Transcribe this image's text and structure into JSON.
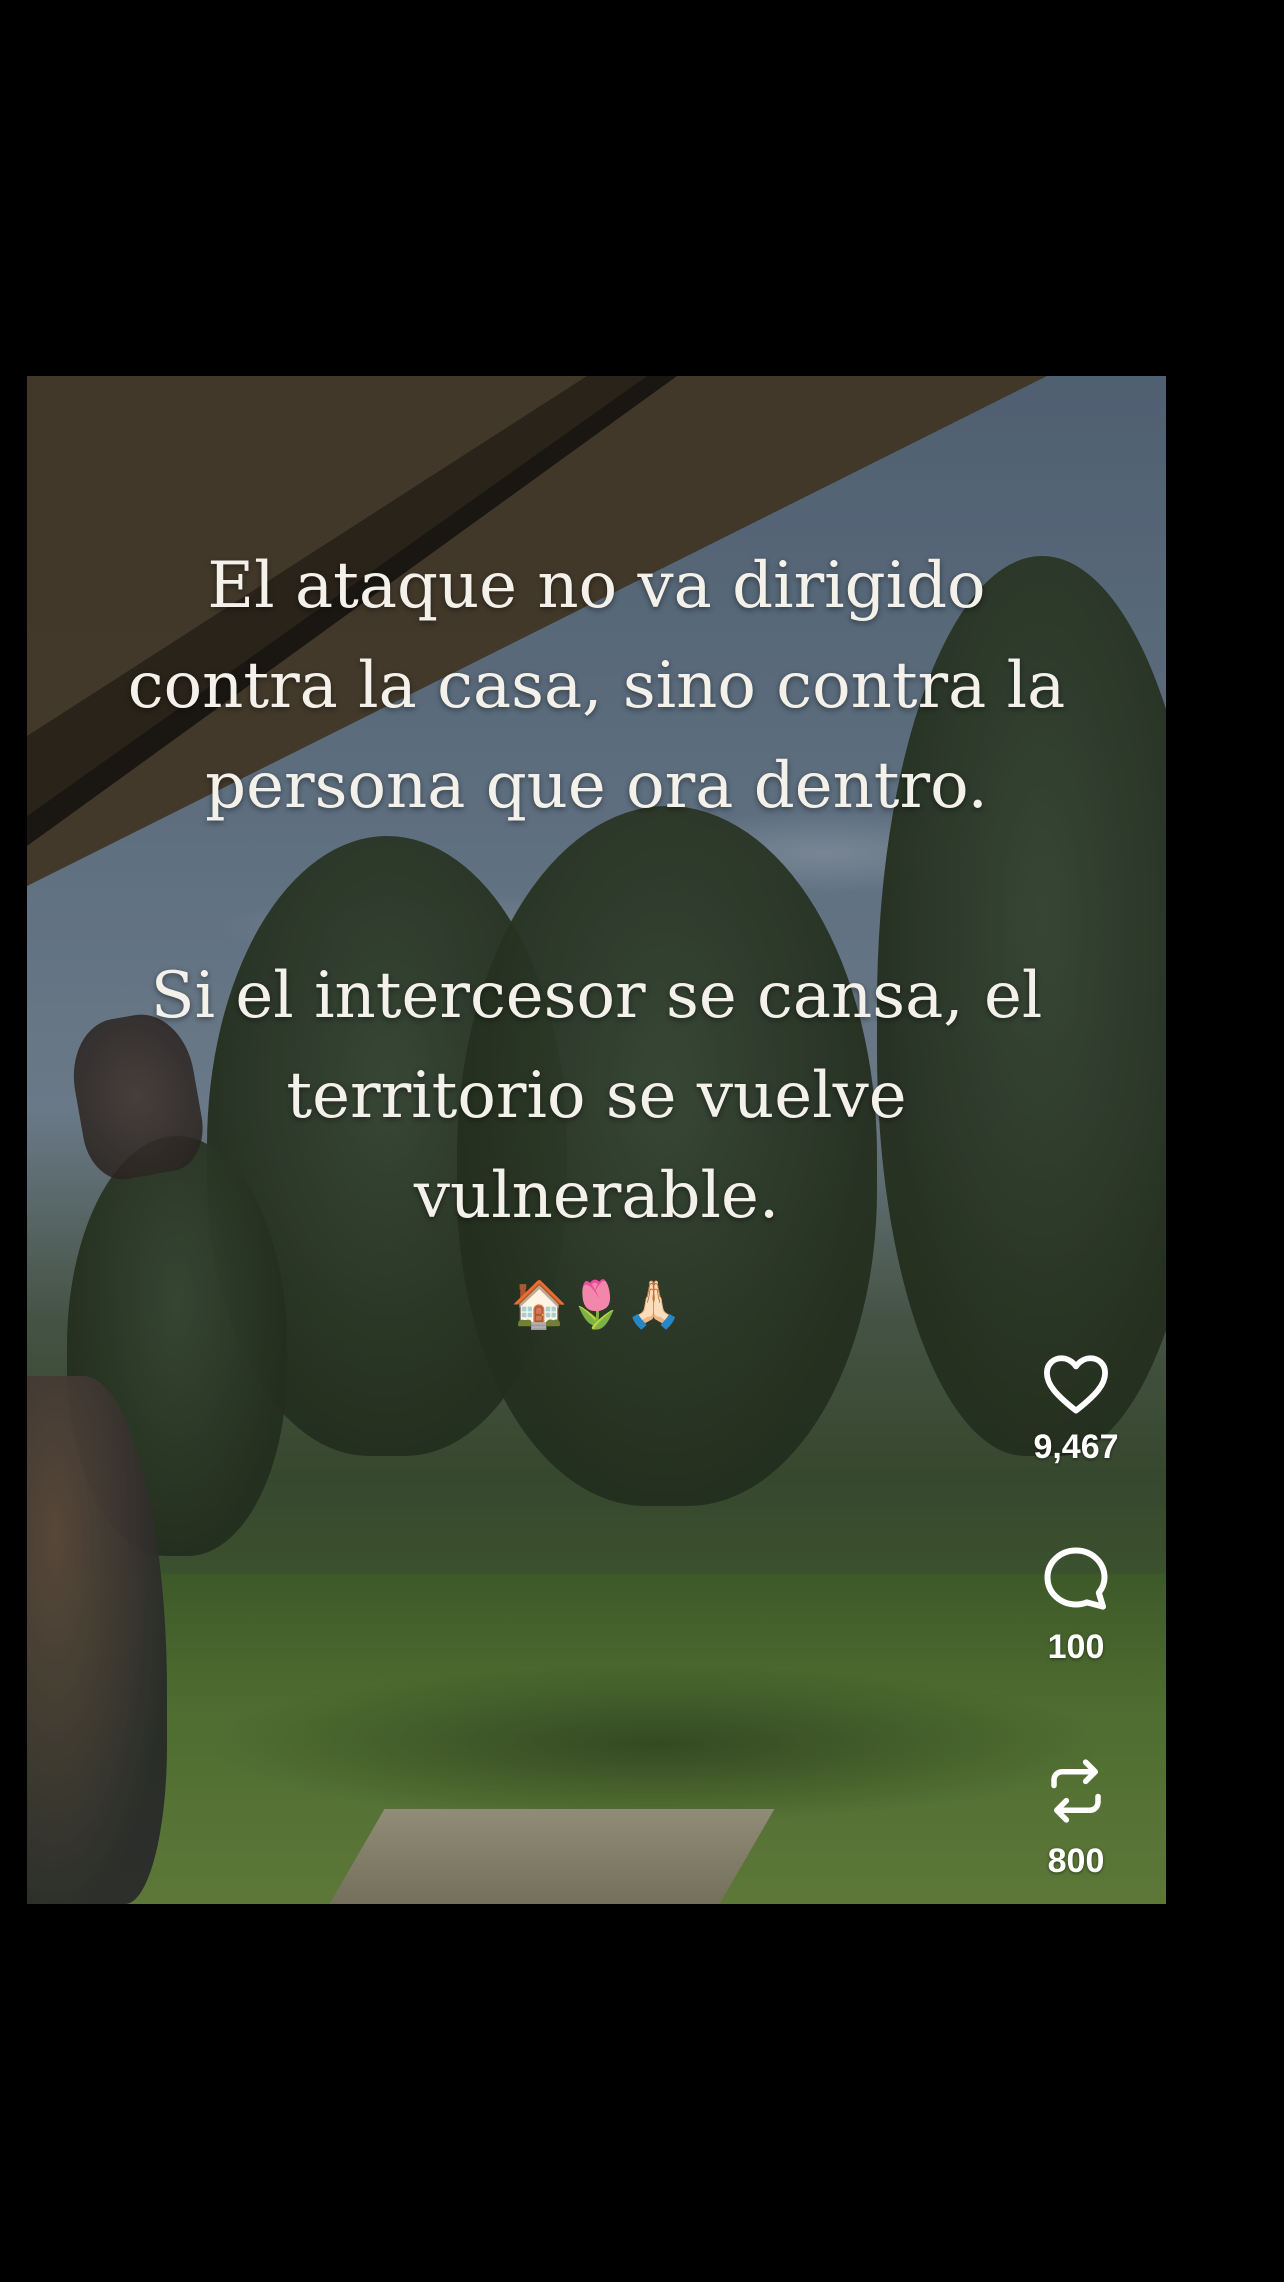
{
  "post": {
    "text_lines_1": "El ataque no va dirigido\ncontra la casa, sino contra la\npersona que ora  dentro.",
    "text_lines_2": "Si el intercesor se cansa, el\nterritorio se vuelve\nvulnerable.",
    "emojis": "🏠🌷🙏🏻"
  },
  "actions": {
    "like": {
      "icon": "heart-icon",
      "count": "9,467"
    },
    "comment": {
      "icon": "comment-bubble-icon",
      "count": "100"
    },
    "repost": {
      "icon": "repost-icon",
      "count": "800"
    }
  }
}
